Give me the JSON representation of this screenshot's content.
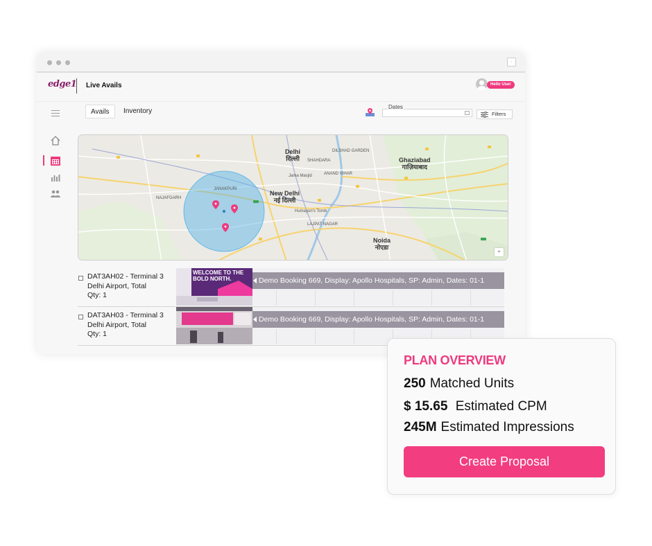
{
  "app": {
    "logo_text": "edge1",
    "title": "Live Avails",
    "user_label": "Hello User"
  },
  "toolbar": {
    "tabs": [
      {
        "label": "Avails",
        "active": true
      },
      {
        "label": "Inventory",
        "active": false
      }
    ],
    "dates_label": "Dates",
    "filters_label": "Filters"
  },
  "sidebar": {
    "items": [
      {
        "icon": "home-icon",
        "active": false
      },
      {
        "icon": "calendar-icon",
        "active": true
      },
      {
        "icon": "analytics-icon",
        "active": false
      },
      {
        "icon": "users-icon",
        "active": false
      }
    ]
  },
  "map": {
    "labels": {
      "delhi": "Delhi",
      "delhi_hi": "दिल्ली",
      "new_delhi": "New Delhi",
      "new_delhi_hi": "नई दिल्ली",
      "ghaziabad": "Ghaziabad",
      "ghaziabad_hi": "गाज़ियाबाद",
      "noida": "Noida",
      "noida_hi": "नोएडा",
      "najafgarh": "NAJAFGARH",
      "janakpuri": "JANAKPURI",
      "jama_masjid": "Jama Masjid",
      "lajpat_nagar": "LAJPAT NAGAR",
      "humayun": "Humayun's Tomb",
      "dilshad": "DILSHAD GARDEN",
      "shahdara": "SHAHDARA",
      "anand_vihar": "ANAND VIHAR"
    }
  },
  "rows": [
    {
      "id_line": "DAT3AH02 - Terminal 3",
      "location": "Delhi Airport, Total",
      "qty": "Qty: 1",
      "thumb_text": "WELCOME TO THE BOLD NORTH.",
      "booking": "Demo Booking 669, Display: Apollo Hospitals, SP: Admin, Dates: 01-1"
    },
    {
      "id_line": "DAT3AH03 - Terminal 3",
      "location": "Delhi Airport, Total",
      "qty": "Qty: 1",
      "thumb_text": "",
      "booking": "Demo Booking 669, Display: Apollo Hospitals, SP: Admin, Dates: 01-1"
    }
  ],
  "plan_overview": {
    "title": "PLAN OVERVIEW",
    "stats": [
      {
        "value": "250",
        "label": "Matched Units"
      },
      {
        "value": "$ 15.65",
        "label": "Estimated CPM"
      },
      {
        "value": "245M",
        "label": "Estimated Impressions"
      }
    ],
    "cta_label": "Create Proposal"
  },
  "colors": {
    "accent": "#ee3a7e",
    "booking_bar": "#9994a0",
    "map_radius": "#4fb1e8"
  }
}
